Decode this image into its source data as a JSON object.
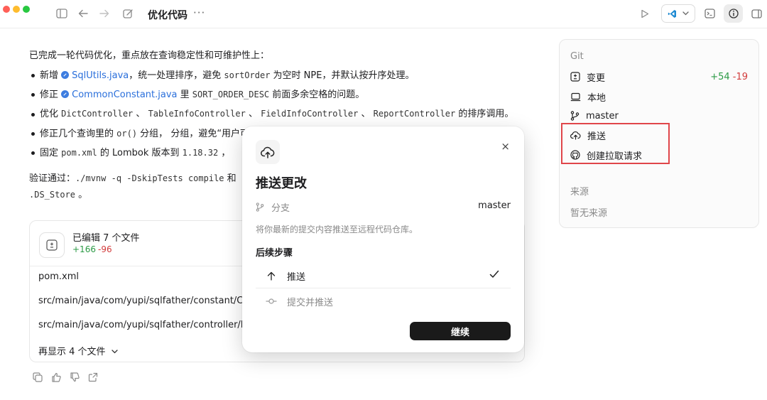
{
  "window": {
    "title": "优化代码",
    "more_label": "···"
  },
  "message": {
    "intro": "已完成一轮代码优化，重点放在查询稳定性和可维护性上：",
    "bullets": [
      {
        "pre": "新增 ",
        "link": "SqlUtils.java",
        "post": "，统一处理排序，避免 ",
        "code": "sortOrder",
        "post2": " 为空时 NPE，并默认按升序处理。"
      },
      {
        "pre": "修正 ",
        "link": "CommonConstant.java",
        "post": " 里 ",
        "code": "SORT_ORDER_DESC",
        "post2": " 前面多余空格的问题。"
      },
      {
        "pre": "优化 ",
        "codes": [
          "DictController",
          "TableInfoController",
          "FieldInfoController",
          "ReportController"
        ],
        "post": " 的排序调用。"
      },
      {
        "pre": "修正几个查询里的 ",
        "code": "or()",
        "post": " 分组，避免“用户可见范"
      },
      {
        "pre": "固定 ",
        "code": "pom.xml",
        "post": " 的 Lombok 版本到 ",
        "code2": "1.18.32",
        "post2": " ，"
      }
    ],
    "verify_label": "验证通过：",
    "verify_cmd": "./mvnw -q -DskipTests compile",
    "verify_tail": " 和",
    "ds_store": ".DS_Store",
    "ds_tail": " 。"
  },
  "files_card": {
    "title": "已编辑 7 个文件",
    "additions": "+166",
    "deletions": "-96",
    "files": [
      "pom.xml",
      "src/main/java/com/yupi/sqlfather/constant/Com",
      "src/main/java/com/yupi/sqlfather/controller/Dict"
    ],
    "show_more": "再显示 4 个文件"
  },
  "git_panel": {
    "title": "Git",
    "changes_label": "变更",
    "additions": "+54",
    "deletions": "-19",
    "local_label": "本地",
    "branch": "master",
    "push_label": "推送",
    "pr_label": "创建拉取请求",
    "source_title": "来源",
    "no_source": "暂无来源"
  },
  "modal": {
    "title": "推送更改",
    "close": "×",
    "branch_label": "分支",
    "branch_value": "master",
    "description": "将你最新的提交内容推送至远程代码仓库。",
    "steps_title": "后续步骤",
    "options": [
      {
        "label": "推送",
        "selected": true
      },
      {
        "label": "提交并推送",
        "selected": false
      }
    ],
    "continue_label": "继续"
  },
  "colors": {
    "accent_link": "#2a6fdb",
    "added": "#2b9a45",
    "removed": "#d23b3b",
    "highlight": "#e0464a"
  }
}
